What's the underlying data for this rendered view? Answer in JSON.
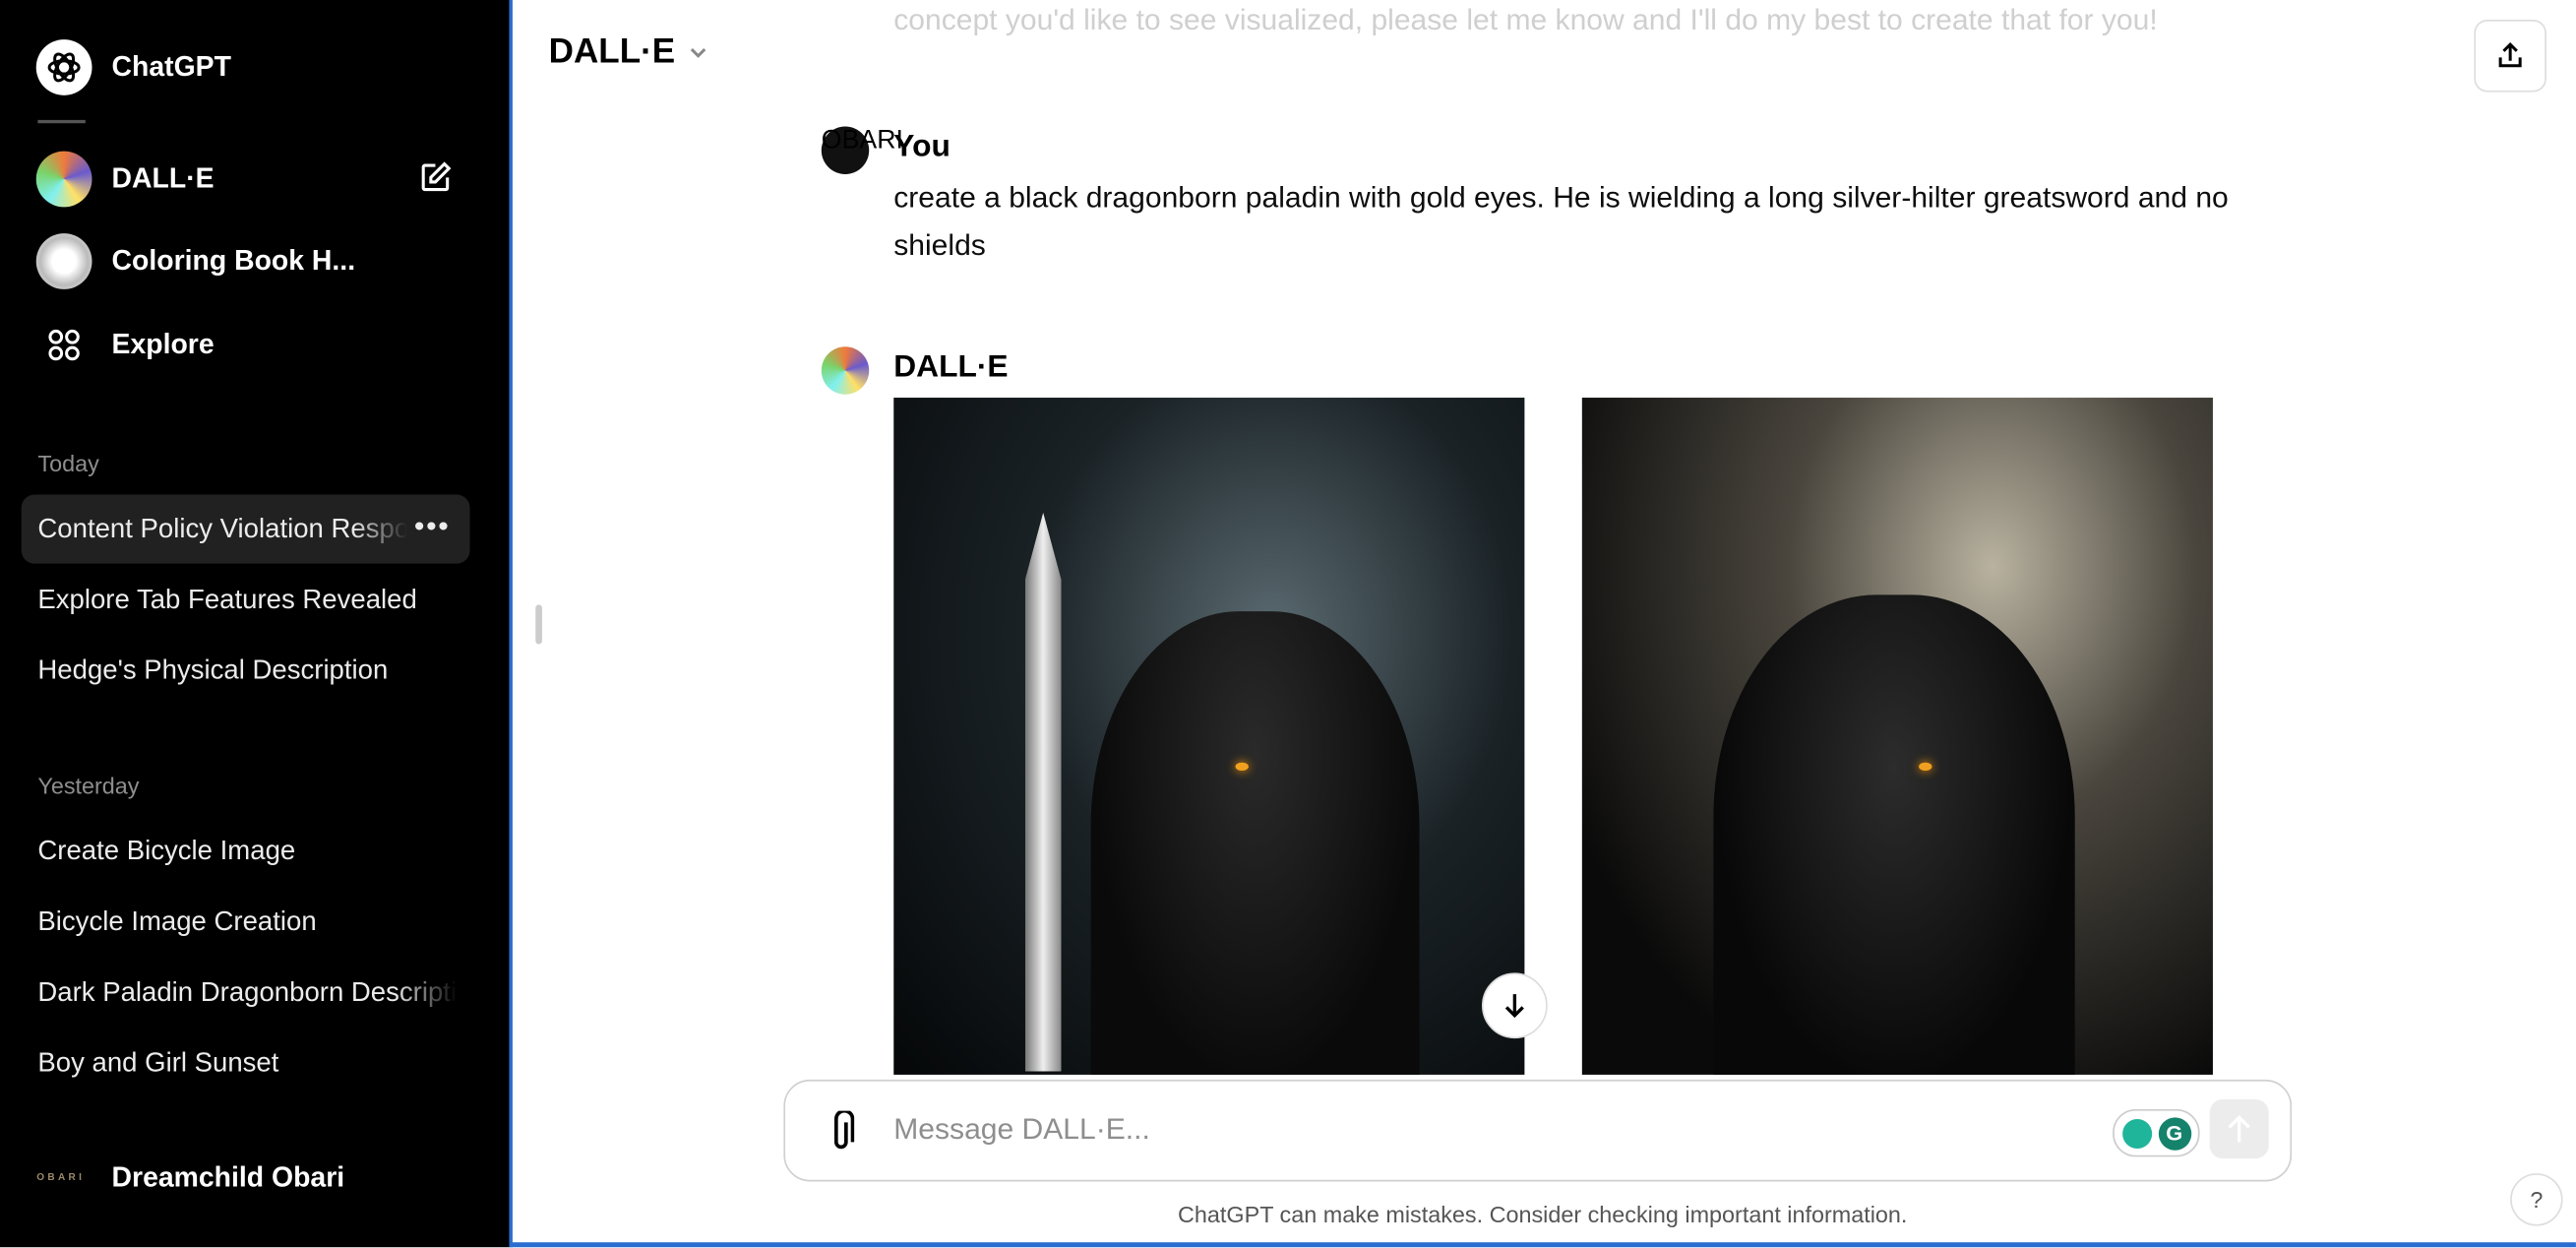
{
  "sidebar": {
    "brand": "ChatGPT",
    "gpts": [
      {
        "label": "DALL·E",
        "icon": "dalle-icon"
      },
      {
        "label": "Coloring Book H...",
        "icon": "coloring-book-icon"
      },
      {
        "label": "Explore",
        "icon": "grid-icon"
      }
    ],
    "sections": [
      {
        "title": "Today",
        "items": [
          "Content Policy Violation Response",
          "Explore Tab Features Revealed",
          "Hedge's Physical Description"
        ]
      },
      {
        "title": "Yesterday",
        "items": [
          "Create Bicycle Image",
          "Bicycle Image Creation",
          "Dark Paladin Dragonborn Description",
          "Boy and Girl Sunset"
        ]
      }
    ],
    "user": {
      "name": "Dreamchild Obari",
      "avatar_text": "OBARI"
    }
  },
  "header": {
    "title": "DALL·E"
  },
  "chat": {
    "previous_tail": "concept you'd like to see visualized, please let me know and I'll do my best to create that for you!",
    "messages": [
      {
        "author": "You",
        "text": "create a black dragonborn paladin with gold eyes. He is wielding a long silver-hilter greatsword and no shields"
      },
      {
        "author": "DALL·E",
        "images": 2
      }
    ]
  },
  "composer": {
    "placeholder": "Message DALL·E..."
  },
  "footer": {
    "disclaimer": "ChatGPT can make mistakes. Consider checking important information.",
    "help": "?"
  },
  "colors": {
    "accent": "#2b6cd0",
    "sidebar_bg": "#000000",
    "grammarly": "#15826b"
  }
}
